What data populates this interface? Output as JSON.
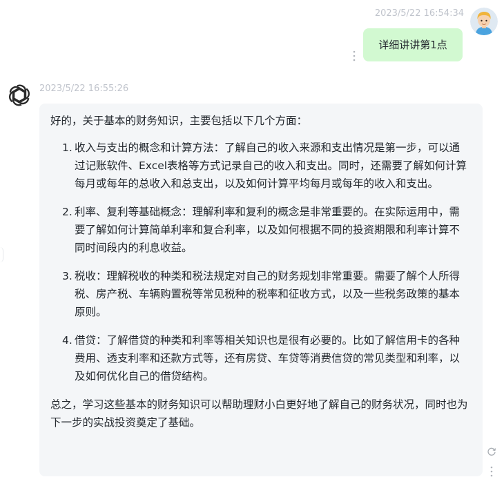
{
  "user": {
    "timestamp": "2023/5/22 16:54:34",
    "avatar_icon": "user-avatar-icon",
    "message": "详细讲讲第1点",
    "bubble_color": "#d2f9d1"
  },
  "assistant": {
    "timestamp": "2023/5/22 16:55:26",
    "avatar_icon": "openai-logo-icon",
    "bubble_color": "#f4f6f8",
    "intro": "好的，关于基本的财务知识，主要包括以下几个方面：",
    "points": [
      {
        "num": "1.",
        "text": "收入与支出的概念和计算方法：了解自己的收入来源和支出情况是第一步，可以通过记账软件、Excel表格等方式记录自己的收入和支出。同时，还需要了解如何计算每月或每年的总收入和总支出，以及如何计算平均每月或每年的收入和支出。"
      },
      {
        "num": "2.",
        "text": "利率、复利等基础概念：理解利率和复利的概念是非常重要的。在实际运用中，需要了解如何计算简单利率和复合利率，以及如何根据不同的投资期限和利率计算不同时间段内的利息收益。"
      },
      {
        "num": "3.",
        "text": "税收：理解税收的种类和税法规定对自己的财务规划非常重要。需要了解个人所得税、房产税、车辆购置税等常见税种的税率和征收方式，以及一些税务政策的基本原则。"
      },
      {
        "num": "4.",
        "text": "借贷：了解借贷的种类和利率等相关知识也是很有必要的。比如了解信用卡的各种费用、透支利率和还款方式等，还有房贷、车贷等消费信贷的常见类型和利率，以及如何优化自己的借贷结构。"
      }
    ],
    "conclusion": "总之，学习这些基本的财务知识可以帮助理财小白更好地了解自己的财务状况，同时也为下一步的实战投资奠定了基础。"
  },
  "icons": {
    "more": "more-vertical-icon",
    "refresh": "refresh-icon"
  }
}
